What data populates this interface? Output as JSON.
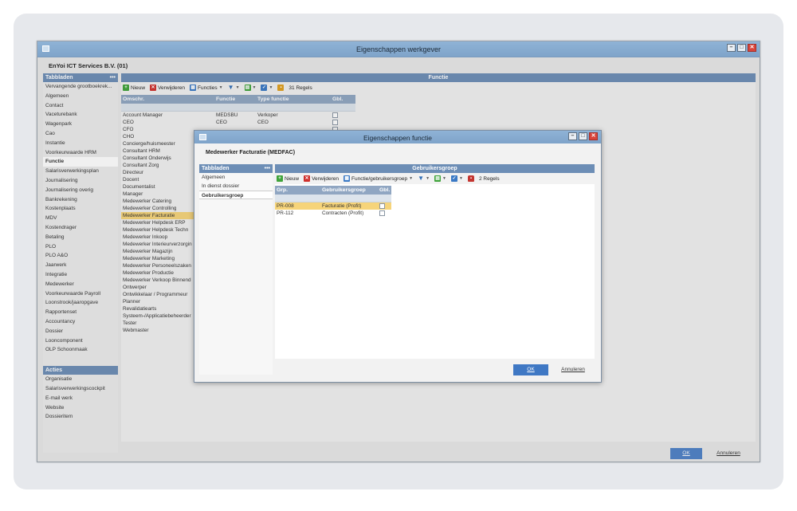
{
  "main_window": {
    "title": "Eigenschappen werkgever",
    "company": "EnYoi ICT Services B.V. (01)",
    "tabbladen_label": "Tabbladen",
    "more_label": "•••",
    "tabs": [
      {
        "label": "Vervangende grootboekrek..."
      },
      {
        "label": "Algemeen"
      },
      {
        "label": "Contact"
      },
      {
        "label": "Vaceturebank"
      },
      {
        "label": "Wagenpark"
      },
      {
        "label": "Cao"
      },
      {
        "label": "Instantie"
      },
      {
        "label": "Voorkeurwaarde HRM"
      },
      {
        "label": "Functie"
      },
      {
        "label": "Salarisverwerkingsplan"
      },
      {
        "label": "Journalisering"
      },
      {
        "label": "Journalisering overig"
      },
      {
        "label": "Bankrekening"
      },
      {
        "label": "Kostenplaats"
      },
      {
        "label": "MDV"
      },
      {
        "label": "Kostendrager"
      },
      {
        "label": "Betaling"
      },
      {
        "label": "PLO"
      },
      {
        "label": "PLO A&O"
      },
      {
        "label": "Jaarwerk"
      },
      {
        "label": "Integratie"
      },
      {
        "label": "Medewerker"
      },
      {
        "label": "Voorkeurwaarde Payroll"
      },
      {
        "label": "Loonstrook/jaaropgave"
      },
      {
        "label": "Rapportenset"
      },
      {
        "label": "Accountancy"
      },
      {
        "label": "Dossier"
      },
      {
        "label": "Looncomponent"
      },
      {
        "label": "OLP Schoonmaak"
      }
    ],
    "acties_label": "Acties",
    "acties": [
      {
        "label": "Organisatie"
      },
      {
        "label": "Salarisverwerkingscockpit"
      },
      {
        "label": "E-mail werk"
      },
      {
        "label": "Website"
      },
      {
        "label": "Dossieritem"
      }
    ],
    "panel_title": "Functie",
    "toolbar": {
      "new": "Nieuw",
      "delete": "Verwijderen",
      "functies": "Functies",
      "count": "31 Regels"
    },
    "columns": [
      "Omschr.",
      "Functie",
      "Type functie",
      "Gbl."
    ],
    "rows": [
      {
        "omschr": "Account Manager",
        "functie": "MEDSBU",
        "type": "Verkoper"
      },
      {
        "omschr": "CEO",
        "functie": "CEO",
        "type": "CEO"
      },
      {
        "omschr": "CFO",
        "functie": "",
        "type": ""
      },
      {
        "omschr": "CHO",
        "functie": "",
        "type": ""
      },
      {
        "omschr": "Concierge/huismeester",
        "functie": "",
        "type": ""
      },
      {
        "omschr": "Consultant HRM",
        "functie": "",
        "type": ""
      },
      {
        "omschr": "Consultant Onderwijs",
        "functie": "",
        "type": ""
      },
      {
        "omschr": "Consultant Zorg",
        "functie": "",
        "type": ""
      },
      {
        "omschr": "Directeur",
        "functie": "",
        "type": ""
      },
      {
        "omschr": "Docent",
        "functie": "",
        "type": ""
      },
      {
        "omschr": "Documentalist",
        "functie": "",
        "type": ""
      },
      {
        "omschr": "Manager",
        "functie": "",
        "type": ""
      },
      {
        "omschr": "Medewerker Catering",
        "functie": "",
        "type": ""
      },
      {
        "omschr": "Medewerker Controlling",
        "functie": "",
        "type": ""
      },
      {
        "omschr": "Medewerker Facturatie",
        "functie": "",
        "type": ""
      },
      {
        "omschr": "Medewerker Helpdesk ERP",
        "functie": "",
        "type": ""
      },
      {
        "omschr": "Medewerker Helpdesk Techn",
        "functie": "",
        "type": ""
      },
      {
        "omschr": "Medewerker Inkoop",
        "functie": "",
        "type": ""
      },
      {
        "omschr": "Medewerker Interieurverzorgin",
        "functie": "",
        "type": ""
      },
      {
        "omschr": "Medewerker Magazijn",
        "functie": "",
        "type": ""
      },
      {
        "omschr": "Medewerker Marketing",
        "functie": "",
        "type": ""
      },
      {
        "omschr": "Medewerker Personeelszaken",
        "functie": "",
        "type": ""
      },
      {
        "omschr": "Medewerker Productie",
        "functie": "",
        "type": ""
      },
      {
        "omschr": "Medewerker Verkoop Binnend",
        "functie": "",
        "type": ""
      },
      {
        "omschr": "Ontwerper",
        "functie": "",
        "type": ""
      },
      {
        "omschr": "Ontwikkelaar / Programmeur",
        "functie": "",
        "type": ""
      },
      {
        "omschr": "Planner",
        "functie": "",
        "type": ""
      },
      {
        "omschr": "Revalidatiearts",
        "functie": "",
        "type": ""
      },
      {
        "omschr": "Systeem-/Applicatiebeheerder",
        "functie": "",
        "type": ""
      },
      {
        "omschr": "Tester",
        "functie": "",
        "type": ""
      },
      {
        "omschr": "Webmaster",
        "functie": "",
        "type": ""
      }
    ],
    "ok_label": "OK",
    "cancel_label": "Annuleren"
  },
  "dialog": {
    "title": "Eigenschappen functie",
    "heading": "Medewerker Facturatie (MEDFAC)",
    "tabbladen_label": "Tabbladen",
    "more_label": "•••",
    "tabs": [
      {
        "label": "Algemeen"
      },
      {
        "label": "In dienst dossier"
      },
      {
        "label": "Gebruikersgroep"
      }
    ],
    "panel_title": "Gebruikersgroep",
    "toolbar": {
      "new": "Nieuw",
      "delete": "Verwijderen",
      "functie_groep": "Functie/gebruikersgroep",
      "count": "2 Regels"
    },
    "columns": [
      "Grp.",
      "Gebruikersgroep",
      "Gbl."
    ],
    "rows": [
      {
        "grp": "PR-008",
        "groep": "Facturatie (Profit)"
      },
      {
        "grp": "PR-112",
        "groep": "Contracten (Profit)"
      }
    ],
    "ok_label": "OK",
    "cancel_label": "Annuleren"
  },
  "colors": {
    "titlebar": "#8fb3d6",
    "panel_header": "#6d8eb6",
    "selection": "#f6d47a",
    "ok_button": "#3f78c4"
  }
}
